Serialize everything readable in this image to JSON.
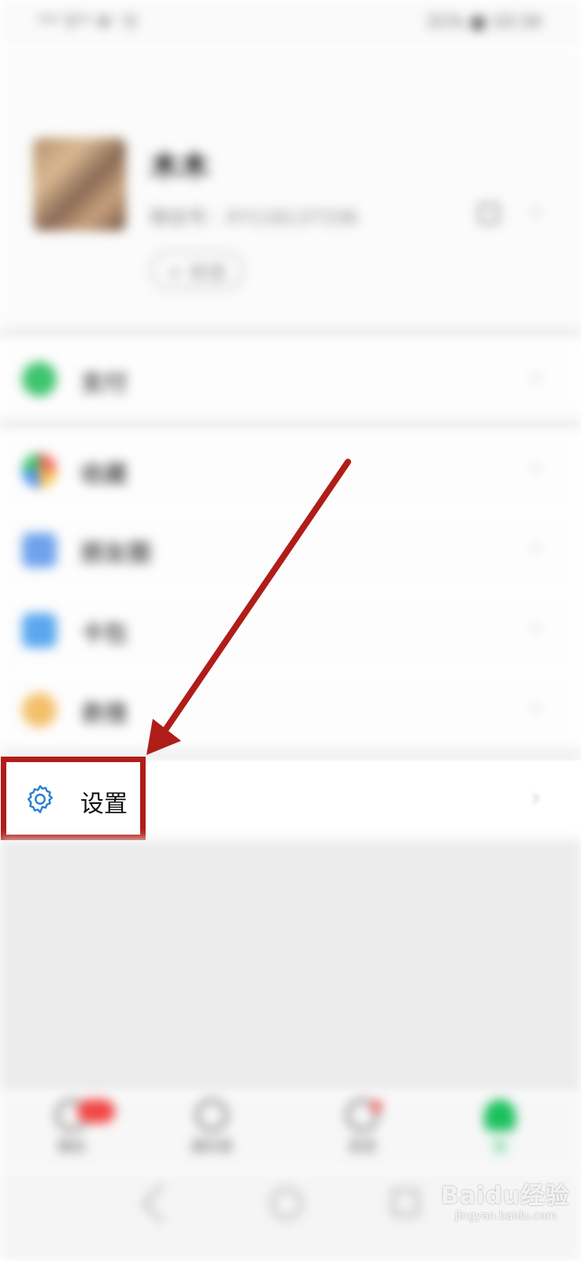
{
  "status_bar": {
    "left": "*ᵃᴵᴵ 5ᴳᴵᴵ ❉ ᴵ 0",
    "right": "31% ■ 10:34"
  },
  "profile": {
    "nickname": "木木",
    "wechat_id": "微信号：XY116137336",
    "status_button": "+ 状态",
    "chevron": "›"
  },
  "menu": {
    "pay": {
      "label": "支付",
      "icon": "wechat-pay-icon"
    },
    "favorites": {
      "label": "收藏",
      "icon": "favorites-icon"
    },
    "moments": {
      "label": "朋友圈",
      "icon": "moments-icon"
    },
    "cards": {
      "label": "卡包",
      "icon": "card-wallet-icon"
    },
    "stickers": {
      "label": "表情",
      "icon": "stickers-icon"
    },
    "settings": {
      "label": "设置",
      "icon": "gear-icon"
    },
    "chevron": "›"
  },
  "tabbar": {
    "tabs": [
      {
        "label": "微信",
        "icon": "chat-icon"
      },
      {
        "label": "通讯录",
        "icon": "contacts-icon"
      },
      {
        "label": "发现",
        "icon": "compass-icon"
      },
      {
        "label": "我",
        "icon": "person-icon"
      }
    ]
  },
  "watermark": {
    "brand": "Baidu经验",
    "url": "jingyan.baidu.com"
  },
  "colors": {
    "accent_green": "#1bc15e",
    "highlight_red": "#b01d19",
    "gear_blue": "#2b7fd0"
  }
}
